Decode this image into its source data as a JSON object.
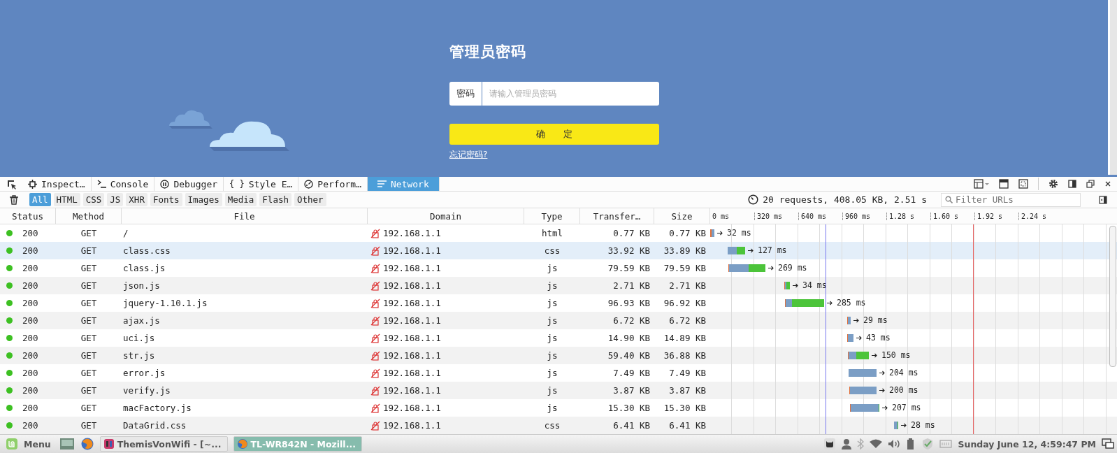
{
  "page": {
    "title": "管理员密码",
    "password_label": "密码",
    "password_placeholder": "请输入管理员密码",
    "confirm_button": "确　　定",
    "forgot_link": "忘记密码?"
  },
  "devtools": {
    "tools": [
      {
        "kind": "inspector",
        "label": "Inspect…",
        "selected": false
      },
      {
        "kind": "console",
        "label": "Console",
        "selected": false
      },
      {
        "kind": "debugger",
        "label": "Debugger",
        "selected": false
      },
      {
        "kind": "style",
        "glyph": "{ }",
        "label": "Style E…",
        "selected": false
      },
      {
        "kind": "performance",
        "label": "Perform…",
        "selected": false
      },
      {
        "kind": "network",
        "label": "Network",
        "selected": true
      }
    ],
    "filters": [
      {
        "label": "All",
        "selected": true
      },
      {
        "label": "HTML",
        "selected": false
      },
      {
        "label": "CSS",
        "selected": false
      },
      {
        "label": "JS",
        "selected": false
      },
      {
        "label": "XHR",
        "selected": false
      },
      {
        "label": "Fonts",
        "selected": false
      },
      {
        "label": "Images",
        "selected": false
      },
      {
        "label": "Media",
        "selected": false
      },
      {
        "label": "Flash",
        "selected": false
      },
      {
        "label": "Other",
        "selected": false
      }
    ],
    "summary": "20 requests, 408.05 KB, 2.51 s",
    "filter_placeholder": "Filter URLs",
    "columns": [
      "Status",
      "Method",
      "File",
      "Domain",
      "Type",
      "Transfer…",
      "Size"
    ],
    "ticks": [
      "0 ms",
      "320 ms",
      "640 ms",
      "960 ms",
      "1.28 s",
      "1.60 s",
      "1.92 s",
      "2.24 s"
    ],
    "rows": [
      {
        "status": "200",
        "method": "GET",
        "file": "/",
        "domain": "192.168.1.1",
        "type": "html",
        "transferred": "0.77 KB",
        "size": "0.77 KB",
        "timing": "32 ms",
        "selected": false
      },
      {
        "status": "200",
        "method": "GET",
        "file": "class.css",
        "domain": "192.168.1.1",
        "type": "css",
        "transferred": "33.92 KB",
        "size": "33.89 KB",
        "timing": "127 ms",
        "selected": true
      },
      {
        "status": "200",
        "method": "GET",
        "file": "class.js",
        "domain": "192.168.1.1",
        "type": "js",
        "transferred": "79.59 KB",
        "size": "79.59 KB",
        "timing": "269 ms",
        "selected": false
      },
      {
        "status": "200",
        "method": "GET",
        "file": "json.js",
        "domain": "192.168.1.1",
        "type": "js",
        "transferred": "2.71 KB",
        "size": "2.71 KB",
        "timing": "34 ms",
        "selected": false
      },
      {
        "status": "200",
        "method": "GET",
        "file": "jquery-1.10.1.js",
        "domain": "192.168.1.1",
        "type": "js",
        "transferred": "96.93 KB",
        "size": "96.92 KB",
        "timing": "285 ms",
        "selected": false
      },
      {
        "status": "200",
        "method": "GET",
        "file": "ajax.js",
        "domain": "192.168.1.1",
        "type": "js",
        "transferred": "6.72 KB",
        "size": "6.72 KB",
        "timing": "29 ms",
        "selected": false
      },
      {
        "status": "200",
        "method": "GET",
        "file": "uci.js",
        "domain": "192.168.1.1",
        "type": "js",
        "transferred": "14.90 KB",
        "size": "14.89 KB",
        "timing": "43 ms",
        "selected": false
      },
      {
        "status": "200",
        "method": "GET",
        "file": "str.js",
        "domain": "192.168.1.1",
        "type": "js",
        "transferred": "59.40 KB",
        "size": "36.88 KB",
        "timing": "150 ms",
        "selected": false
      },
      {
        "status": "200",
        "method": "GET",
        "file": "error.js",
        "domain": "192.168.1.1",
        "type": "js",
        "transferred": "7.49 KB",
        "size": "7.49 KB",
        "timing": "204 ms",
        "selected": false
      },
      {
        "status": "200",
        "method": "GET",
        "file": "verify.js",
        "domain": "192.168.1.1",
        "type": "js",
        "transferred": "3.87 KB",
        "size": "3.87 KB",
        "timing": "200 ms",
        "selected": false
      },
      {
        "status": "200",
        "method": "GET",
        "file": "macFactory.js",
        "domain": "192.168.1.1",
        "type": "js",
        "transferred": "15.30 KB",
        "size": "15.30 KB",
        "timing": "207 ms",
        "selected": false
      },
      {
        "status": "200",
        "method": "GET",
        "file": "DataGrid.css",
        "domain": "192.168.1.1",
        "type": "css",
        "transferred": "6.41 KB",
        "size": "6.41 KB",
        "timing": "28 ms",
        "selected": false
      }
    ]
  },
  "taskbar": {
    "menu_label": "Menu",
    "windows": [
      {
        "kind": "terminal",
        "title": "ThemisVonWifi - [~...",
        "selected": false
      },
      {
        "kind": "firefox",
        "title": "TL-WR842N - Mozill...",
        "selected": true
      }
    ],
    "clock": "Sunday June 12,  4:59:47 PM"
  }
}
